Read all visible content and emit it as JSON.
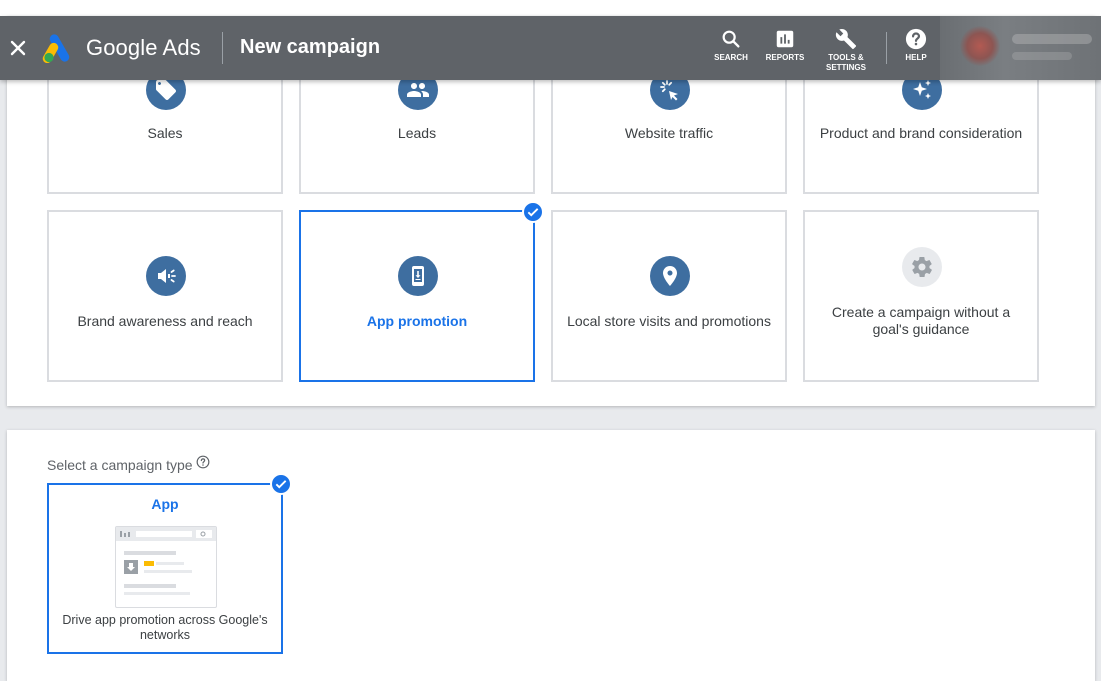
{
  "header": {
    "title": "Google Ads",
    "page_title": "New campaign",
    "tools": [
      {
        "label": "SEARCH",
        "icon": "search-icon"
      },
      {
        "label": "REPORTS",
        "icon": "reports-icon"
      },
      {
        "label": "TOOLS &",
        "label2": "SETTINGS",
        "icon": "wrench-icon"
      },
      {
        "label": "HELP",
        "icon": "help-icon"
      }
    ]
  },
  "goals": {
    "row1": [
      {
        "label": "Sales",
        "icon": "tag-icon"
      },
      {
        "label": "Leads",
        "icon": "people-icon"
      },
      {
        "label": "Website traffic",
        "icon": "cursor-click-icon"
      },
      {
        "label": "Product and brand consideration",
        "icon": "sparkle-icon"
      }
    ],
    "row2": [
      {
        "label": "Brand awareness and reach",
        "icon": "megaphone-icon"
      },
      {
        "label": "App promotion",
        "icon": "phone-download-icon",
        "selected": true
      },
      {
        "label": "Local store visits and promotions",
        "icon": "location-pin-icon"
      },
      {
        "label": "Create a campaign without a goal's guidance",
        "icon": "gear-icon"
      }
    ]
  },
  "campaign_type": {
    "section_label": "Select a campaign type",
    "card": {
      "title": "App",
      "description": "Drive app promotion across Google's networks",
      "selected": true
    }
  },
  "colors": {
    "appbar": "#5f6368",
    "accent": "#1a73e8",
    "goal_icon_bg": "#3e6ea0",
    "card_border": "#dadce0"
  }
}
